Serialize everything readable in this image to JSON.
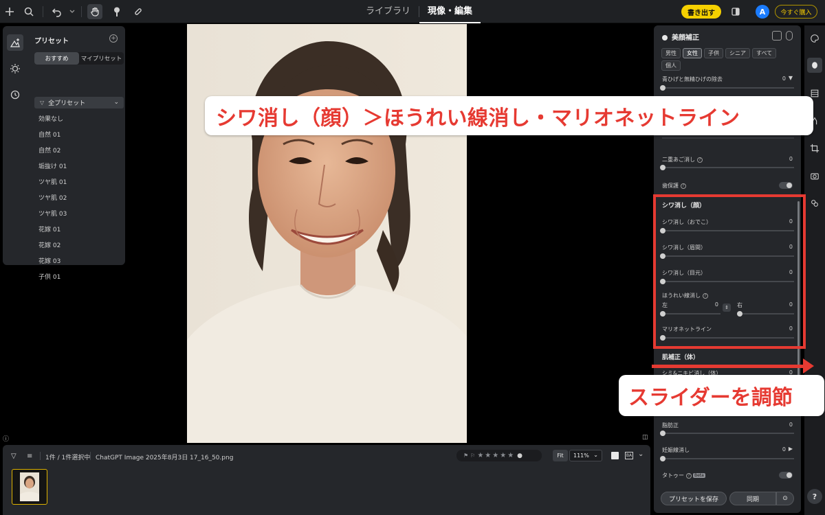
{
  "topbar": {
    "tabs": [
      {
        "label": "ライブラリ",
        "active": false
      },
      {
        "label": "現像・編集",
        "active": true
      }
    ],
    "export_label": "書き出す",
    "avatar_letter": "A",
    "buy_label": "今すぐ購入"
  },
  "presets": {
    "title": "プリセット",
    "segments": [
      "おすすめ",
      "マイプリセット"
    ],
    "active_segment": 0,
    "filter_label": "全プリセット",
    "items": [
      "効果なし",
      "自然 01",
      "自然 02",
      "垢抜け 01",
      "ツヤ肌 01",
      "ツヤ肌 02",
      "ツヤ肌 03",
      "花嫁 01",
      "花嫁 02",
      "花嫁 03",
      "子供 01"
    ]
  },
  "panel": {
    "title": "美顔補正",
    "chips": [
      {
        "label": "男性",
        "on": false
      },
      {
        "label": "女性",
        "on": true
      },
      {
        "label": "子供",
        "on": false
      },
      {
        "label": "シニア",
        "on": false
      },
      {
        "label": "すべて",
        "on": false
      },
      {
        "label": "個人",
        "on": false
      }
    ],
    "beard": {
      "label": "青ひげと無精ひげの除去",
      "value": "0"
    },
    "double_chin": {
      "label": "二重あご消し",
      "value": "0"
    },
    "teeth_protect": {
      "label": "歯保護"
    },
    "wrinkle_section": "シワ消し（顔）",
    "forehead": {
      "label": "シワ消し（おでこ）",
      "value": "0"
    },
    "brow": {
      "label": "シワ消し（眉間）",
      "value": "0"
    },
    "eyes": {
      "label": "シワ消し（目元）",
      "value": "0"
    },
    "nasolabial": {
      "label": "ほうれい線消し",
      "left_label": "左",
      "left_value": "0",
      "right_label": "右",
      "right_value": "0"
    },
    "marionette": {
      "label": "マリオネットライン",
      "value": "0"
    },
    "body_section": "肌補正（体）",
    "body_blemish": {
      "label": "シミ&ニキビ消し（体）",
      "value": "0"
    },
    "fat": {
      "label": "脂肪正",
      "value": "0"
    },
    "stretch": {
      "label": "妊娠線消し",
      "value": "0"
    },
    "tattoo": {
      "label": "タトゥー",
      "badge": "Beta"
    },
    "save_preset": "プリセットを保存",
    "sync": "同期"
  },
  "bottom": {
    "selection": "1件 / 1件選択中",
    "filename": "ChatGPT Image 2025年8月3日 17_16_50.png",
    "fit": "Fit",
    "zoom": "111%",
    "stars": "★★★★★"
  },
  "annotations": {
    "callout_main": "シワ消し（顔）＞ほうれい線消し・マリオネットライン",
    "callout_slider": "スライダーを調節",
    "accent_color": "#e63a32"
  }
}
